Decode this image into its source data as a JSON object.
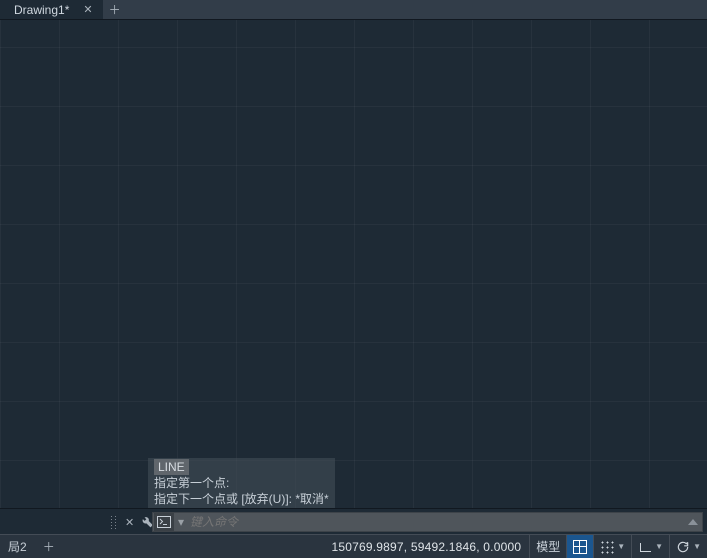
{
  "tabs": {
    "active": {
      "title": "Drawing1*"
    }
  },
  "cmd_history": {
    "command": "LINE",
    "line1": "指定第一个点:",
    "line2": "指定下一个点或 [放弃(U)]: *取消*"
  },
  "cmdline": {
    "placeholder": "键入命令"
  },
  "status": {
    "layout_label": "局2",
    "coords": "150769.9897, 59492.1846, 0.0000",
    "model_label": "模型"
  }
}
